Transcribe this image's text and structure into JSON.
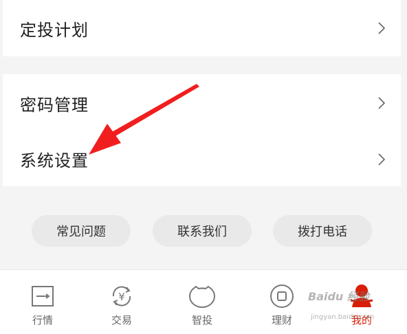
{
  "menu": {
    "plan": "定投计划",
    "password": "密码管理",
    "settings": "系统设置"
  },
  "buttons": {
    "faq": "常见问题",
    "contact": "联系我们",
    "call": "拨打电话"
  },
  "tabs": [
    {
      "label": "行情",
      "icon": "market-icon"
    },
    {
      "label": "交易",
      "icon": "yen-exchange-icon"
    },
    {
      "label": "智投",
      "icon": "smart-invest-icon"
    },
    {
      "label": "理财",
      "icon": "wealth-icon"
    },
    {
      "label": "我的",
      "icon": "profile-icon"
    }
  ],
  "active_tab": "我的",
  "watermark": {
    "text": "Baidu 经验",
    "sub": "jingyan.baidu.com"
  },
  "colors": {
    "accent": "#d81e06",
    "arrow": "#f01e1e",
    "background": "#f4f4f4"
  }
}
